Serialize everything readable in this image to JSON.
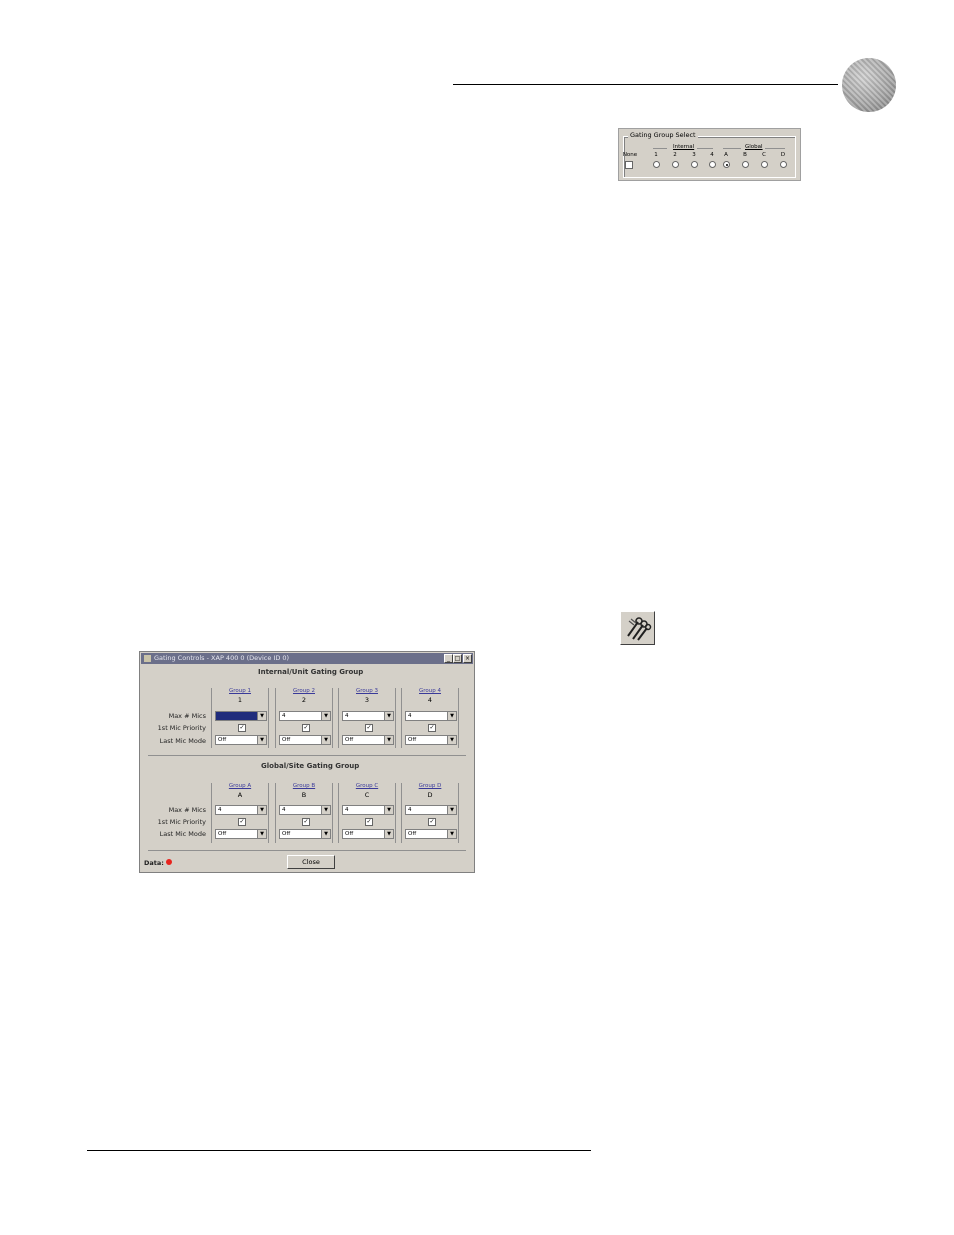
{
  "gating_group_select": {
    "title": "Gating Group Select",
    "internal_label": "Internal",
    "global_label": "Global",
    "none_label": "None",
    "options": [
      "1",
      "2",
      "3",
      "4",
      "A",
      "B",
      "C",
      "D"
    ],
    "selected": "A"
  },
  "window": {
    "title": "Gating Controls - XAP 400 0 (Device ID 0)",
    "internal_section_title": "Internal/Unit Gating Group",
    "global_section_title": "Global/Site Gating Group",
    "row_labels": {
      "max_mics": "Max # Mics",
      "first_mic_priority": "1st Mic Priority",
      "last_mic_mode": "Last Mic Mode"
    },
    "internal_groups": [
      {
        "link": "Group 1",
        "number": "1",
        "max_mics": "",
        "priority": "✓",
        "last_mic": "Off"
      },
      {
        "link": "Group 2",
        "number": "2",
        "max_mics": "4",
        "priority": "✓",
        "last_mic": "Off"
      },
      {
        "link": "Group 3",
        "number": "3",
        "max_mics": "4",
        "priority": "✓",
        "last_mic": "Off"
      },
      {
        "link": "Group 4",
        "number": "4",
        "max_mics": "4",
        "priority": "✓",
        "last_mic": "Off"
      }
    ],
    "global_groups": [
      {
        "link": "Group A",
        "number": "A",
        "max_mics": "4",
        "priority": "✓",
        "last_mic": "Off"
      },
      {
        "link": "Group B",
        "number": "B",
        "max_mics": "4",
        "priority": "✓",
        "last_mic": "Off"
      },
      {
        "link": "Group C",
        "number": "C",
        "max_mics": "4",
        "priority": "✓",
        "last_mic": "Off"
      },
      {
        "link": "Group D",
        "number": "D",
        "max_mics": "4",
        "priority": "✓",
        "last_mic": "Off"
      }
    ],
    "data_label": "Data:",
    "close_label": "Close",
    "status_led_color": "#e8231d"
  },
  "icons": {
    "logo": "speaker-grille-logo",
    "toolbar": "gating-tools-icon"
  }
}
